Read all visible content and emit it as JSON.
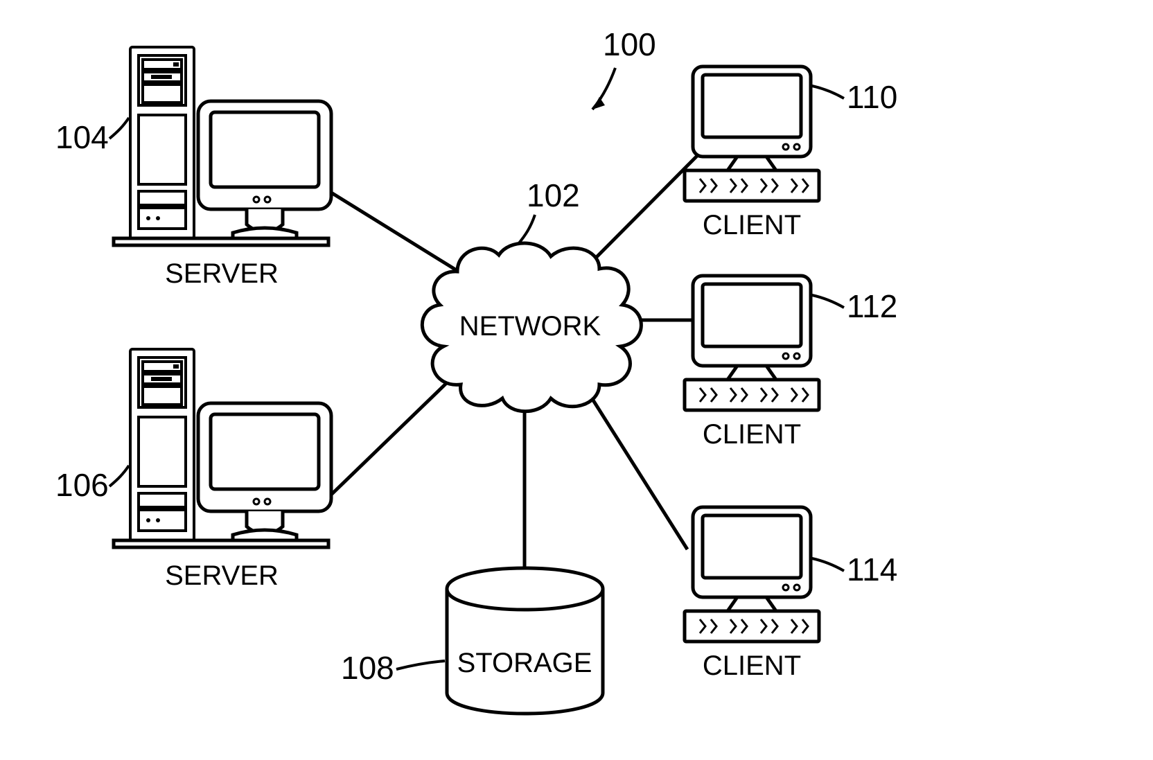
{
  "refs": {
    "system": "100",
    "network": "102",
    "server1": "104",
    "server2": "106",
    "storage": "108",
    "client1": "110",
    "client2": "112",
    "client3": "114"
  },
  "labels": {
    "network": "NETWORK",
    "server": "SERVER",
    "client": "CLIENT",
    "storage": "STORAGE"
  }
}
